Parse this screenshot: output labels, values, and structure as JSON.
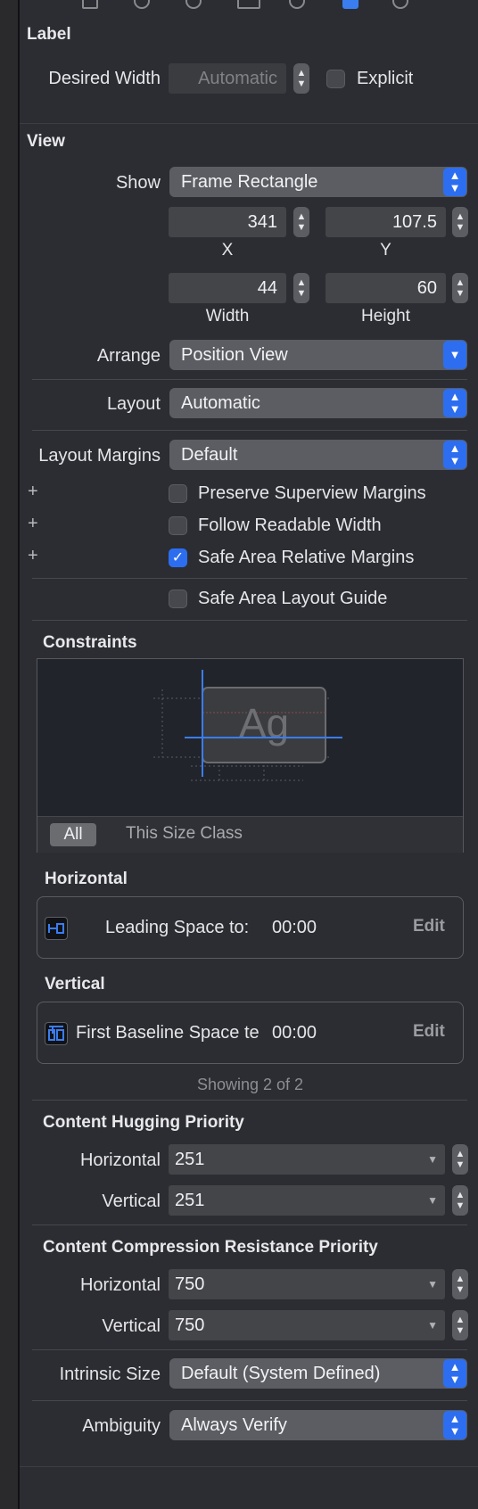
{
  "label_section": {
    "title": "Label",
    "desired_width_label": "Desired Width",
    "desired_width_placeholder": "Automatic",
    "explicit_label": "Explicit"
  },
  "view_section": {
    "title": "View",
    "show_label": "Show",
    "show_value": "Frame Rectangle",
    "x_value": "341",
    "x_label": "X",
    "y_value": "107.5",
    "y_label": "Y",
    "width_value": "44",
    "width_label": "Width",
    "height_value": "60",
    "height_label": "Height",
    "arrange_label": "Arrange",
    "arrange_value": "Position View",
    "layout_label": "Layout",
    "layout_value": "Automatic",
    "layout_margins_label": "Layout Margins",
    "layout_margins_value": "Default",
    "preserve_label": "Preserve Superview Margins",
    "follow_label": "Follow Readable Width",
    "safe_area_margins_label": "Safe Area Relative Margins",
    "safe_area_guide_label": "Safe Area Layout Guide"
  },
  "constraints": {
    "title": "Constraints",
    "preview_text": "Ag",
    "tab_all": "All",
    "tab_size_class": "This Size Class",
    "horizontal_title": "Horizontal",
    "horizontal_text": "Leading Space to:",
    "horizontal_value": "00:00",
    "vertical_title": "Vertical",
    "vertical_text": "First Baseline Space tе",
    "vertical_value": "00:00",
    "edit_label": "Edit",
    "showing": "Showing 2 of 2"
  },
  "hugging": {
    "title": "Content Hugging Priority",
    "horizontal_label": "Horizontal",
    "horizontal_value": "251",
    "vertical_label": "Vertical",
    "vertical_value": "251"
  },
  "compression": {
    "title": "Content Compression Resistance Priority",
    "horizontal_label": "Horizontal",
    "horizontal_value": "750",
    "vertical_label": "Vertical",
    "vertical_value": "750"
  },
  "intrinsic": {
    "label": "Intrinsic Size",
    "value": "Default (System Defined)"
  },
  "ambiguity": {
    "label": "Ambiguity",
    "value": "Always Verify"
  },
  "colors": {
    "accent": "#2d6ef0",
    "panel": "#2b2d33"
  }
}
